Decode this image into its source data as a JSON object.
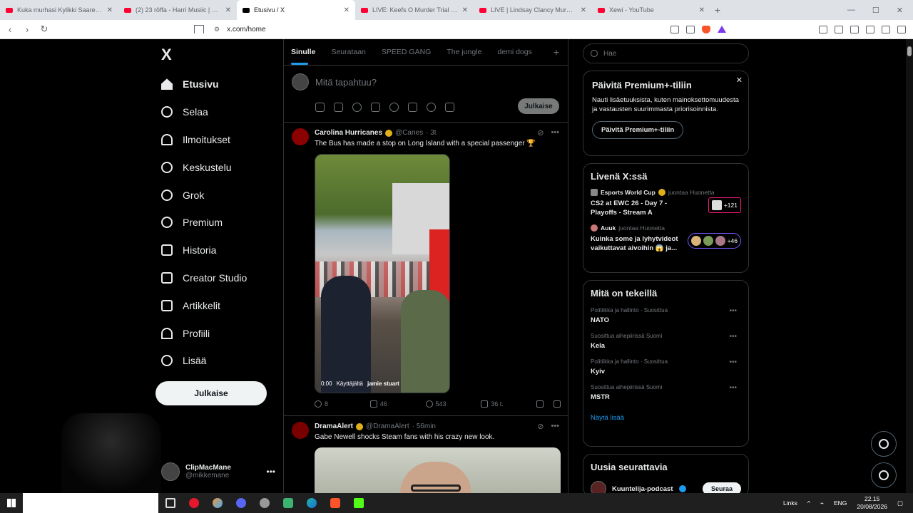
{
  "browser": {
    "tabs": [
      {
        "title": "Kuka murhasi Kylikki Saaren? | 23 r..."
      },
      {
        "title": "(2) 23 röffa - Harri Musiic | 24 - YouT..."
      },
      {
        "title": "Etusivu / X"
      },
      {
        "title": "LIVE: Keefs O Murder Trial Day 4 | Off..."
      },
      {
        "title": "LIVE | Lindsay Clancy Murder Tria..."
      },
      {
        "title": "Xewi - YouTube"
      }
    ],
    "url": "x.com/home"
  },
  "sidebar": {
    "logo": "X",
    "items": [
      {
        "label": "Etusivu"
      },
      {
        "label": "Selaa"
      },
      {
        "label": "Ilmoitukset"
      },
      {
        "label": "Keskustelu"
      },
      {
        "label": "Grok"
      },
      {
        "label": "Premium"
      },
      {
        "label": "Historia"
      },
      {
        "label": "Creator Studio"
      },
      {
        "label": "Artikkelit"
      },
      {
        "label": "Profiili"
      },
      {
        "label": "Lisää"
      }
    ],
    "post_button": "Julkaise",
    "profile": {
      "name": "ClipMacMane",
      "handle": "@mikkemane"
    }
  },
  "feed": {
    "tabs": [
      {
        "label": "Sinulle"
      },
      {
        "label": "Seurataan"
      },
      {
        "label": "SPEED GANG"
      },
      {
        "label": "The jungle"
      },
      {
        "label": "demi dogs"
      }
    ],
    "composer_placeholder": "Mitä tapahtuu?",
    "composer_post": "Julkaise",
    "tweets": [
      {
        "name": "Carolina Hurricanes",
        "handle": "@Canes",
        "time": "· 3t",
        "text": "The Bus has made a stop on Long Island with a special passenger 🏆",
        "video_time": "0:00",
        "video_caption_prefix": "Käyttäjältä",
        "video_caption_user": "jamie stuart",
        "replies": "8",
        "reposts": "46",
        "likes": "543",
        "views": "36 t."
      },
      {
        "name": "DramaAlert",
        "handle": "@DramaAlert",
        "time": "· 56min",
        "text": "Gabe Newell shocks Steam fans with his crazy new look."
      }
    ]
  },
  "right": {
    "search_placeholder": "Hae",
    "premium": {
      "title": "Päivitä Premium+-tiliin",
      "text": "Nauti lisäetuuksista, kuten mainoksettomuudesta ja vastausten suurimmasta priorisoinnista.",
      "button": "Päivitä Premium+-tiliin"
    },
    "live": {
      "title": "Livenä X:ssä",
      "items": [
        {
          "host": "Esports World Cup",
          "suffix": "juontaa Huonetta",
          "title": "CS2 at EWC 26 - Day 7 - Playoffs - Stream A",
          "count": "+121"
        },
        {
          "host": "Auuk",
          "suffix": "juontaa Huonetta",
          "title": "Kuinka some ja lyhytvideot vaikuttavat aivoihin 😱 ja...",
          "count": "+46"
        }
      ]
    },
    "trends": {
      "title": "Mitä on tekeillä",
      "items": [
        {
          "meta": "Politiikka ja hallinto · Suosittua",
          "name": "NATO"
        },
        {
          "meta": "Suosittua aihepiirissä Suomi",
          "name": "Kela"
        },
        {
          "meta": "Politiikka ja hallinto · Suosittua",
          "name": "Kyiv"
        },
        {
          "meta": "Suosittua aihepiirissä Suomi",
          "name": "MSTR"
        }
      ],
      "show_more": "Näytä lisää"
    },
    "follow": {
      "title": "Uusia seurattavia",
      "name": "Kuuntelija-podcast",
      "button": "Seuraa"
    }
  },
  "taskbar": {
    "links": "Links",
    "lang": "ENG",
    "time": "22.15",
    "date": "20/08/2026"
  }
}
